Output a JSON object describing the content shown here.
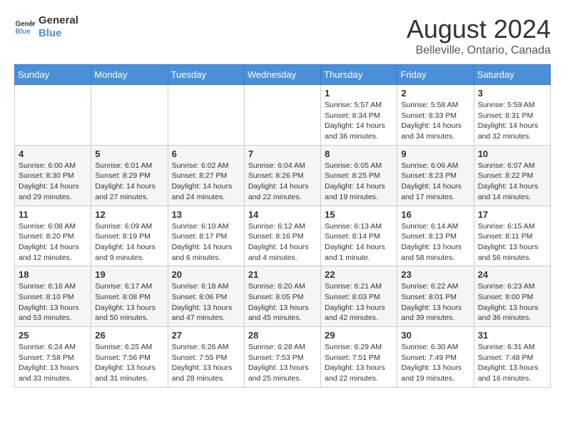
{
  "header": {
    "logo_line1": "General",
    "logo_line2": "Blue",
    "main_title": "August 2024",
    "subtitle": "Belleville, Ontario, Canada"
  },
  "columns": [
    "Sunday",
    "Monday",
    "Tuesday",
    "Wednesday",
    "Thursday",
    "Friday",
    "Saturday"
  ],
  "weeks": [
    [
      {
        "day": "",
        "info": ""
      },
      {
        "day": "",
        "info": ""
      },
      {
        "day": "",
        "info": ""
      },
      {
        "day": "",
        "info": ""
      },
      {
        "day": "1",
        "info": "Sunrise: 5:57 AM\nSunset: 8:34 PM\nDaylight: 14 hours and 36 minutes."
      },
      {
        "day": "2",
        "info": "Sunrise: 5:58 AM\nSunset: 8:33 PM\nDaylight: 14 hours and 34 minutes."
      },
      {
        "day": "3",
        "info": "Sunrise: 5:59 AM\nSunset: 8:31 PM\nDaylight: 14 hours and 32 minutes."
      }
    ],
    [
      {
        "day": "4",
        "info": "Sunrise: 6:00 AM\nSunset: 8:30 PM\nDaylight: 14 hours and 29 minutes."
      },
      {
        "day": "5",
        "info": "Sunrise: 6:01 AM\nSunset: 8:29 PM\nDaylight: 14 hours and 27 minutes."
      },
      {
        "day": "6",
        "info": "Sunrise: 6:02 AM\nSunset: 8:27 PM\nDaylight: 14 hours and 24 minutes."
      },
      {
        "day": "7",
        "info": "Sunrise: 6:04 AM\nSunset: 8:26 PM\nDaylight: 14 hours and 22 minutes."
      },
      {
        "day": "8",
        "info": "Sunrise: 6:05 AM\nSunset: 8:25 PM\nDaylight: 14 hours and 19 minutes."
      },
      {
        "day": "9",
        "info": "Sunrise: 6:06 AM\nSunset: 8:23 PM\nDaylight: 14 hours and 17 minutes."
      },
      {
        "day": "10",
        "info": "Sunrise: 6:07 AM\nSunset: 8:22 PM\nDaylight: 14 hours and 14 minutes."
      }
    ],
    [
      {
        "day": "11",
        "info": "Sunrise: 6:08 AM\nSunset: 8:20 PM\nDaylight: 14 hours and 12 minutes."
      },
      {
        "day": "12",
        "info": "Sunrise: 6:09 AM\nSunset: 8:19 PM\nDaylight: 14 hours and 9 minutes."
      },
      {
        "day": "13",
        "info": "Sunrise: 6:10 AM\nSunset: 8:17 PM\nDaylight: 14 hours and 6 minutes."
      },
      {
        "day": "14",
        "info": "Sunrise: 6:12 AM\nSunset: 8:16 PM\nDaylight: 14 hours and 4 minutes."
      },
      {
        "day": "15",
        "info": "Sunrise: 6:13 AM\nSunset: 8:14 PM\nDaylight: 14 hours and 1 minute."
      },
      {
        "day": "16",
        "info": "Sunrise: 6:14 AM\nSunset: 8:13 PM\nDaylight: 13 hours and 58 minutes."
      },
      {
        "day": "17",
        "info": "Sunrise: 6:15 AM\nSunset: 8:11 PM\nDaylight: 13 hours and 56 minutes."
      }
    ],
    [
      {
        "day": "18",
        "info": "Sunrise: 6:16 AM\nSunset: 8:10 PM\nDaylight: 13 hours and 53 minutes."
      },
      {
        "day": "19",
        "info": "Sunrise: 6:17 AM\nSunset: 8:08 PM\nDaylight: 13 hours and 50 minutes."
      },
      {
        "day": "20",
        "info": "Sunrise: 6:18 AM\nSunset: 8:06 PM\nDaylight: 13 hours and 47 minutes."
      },
      {
        "day": "21",
        "info": "Sunrise: 6:20 AM\nSunset: 8:05 PM\nDaylight: 13 hours and 45 minutes."
      },
      {
        "day": "22",
        "info": "Sunrise: 6:21 AM\nSunset: 8:03 PM\nDaylight: 13 hours and 42 minutes."
      },
      {
        "day": "23",
        "info": "Sunrise: 6:22 AM\nSunset: 8:01 PM\nDaylight: 13 hours and 39 minutes."
      },
      {
        "day": "24",
        "info": "Sunrise: 6:23 AM\nSunset: 8:00 PM\nDaylight: 13 hours and 36 minutes."
      }
    ],
    [
      {
        "day": "25",
        "info": "Sunrise: 6:24 AM\nSunset: 7:58 PM\nDaylight: 13 hours and 33 minutes."
      },
      {
        "day": "26",
        "info": "Sunrise: 6:25 AM\nSunset: 7:56 PM\nDaylight: 13 hours and 31 minutes."
      },
      {
        "day": "27",
        "info": "Sunrise: 6:26 AM\nSunset: 7:55 PM\nDaylight: 13 hours and 28 minutes."
      },
      {
        "day": "28",
        "info": "Sunrise: 6:28 AM\nSunset: 7:53 PM\nDaylight: 13 hours and 25 minutes."
      },
      {
        "day": "29",
        "info": "Sunrise: 6:29 AM\nSunset: 7:51 PM\nDaylight: 13 hours and 22 minutes."
      },
      {
        "day": "30",
        "info": "Sunrise: 6:30 AM\nSunset: 7:49 PM\nDaylight: 13 hours and 19 minutes."
      },
      {
        "day": "31",
        "info": "Sunrise: 6:31 AM\nSunset: 7:48 PM\nDaylight: 13 hours and 16 minutes."
      }
    ]
  ]
}
